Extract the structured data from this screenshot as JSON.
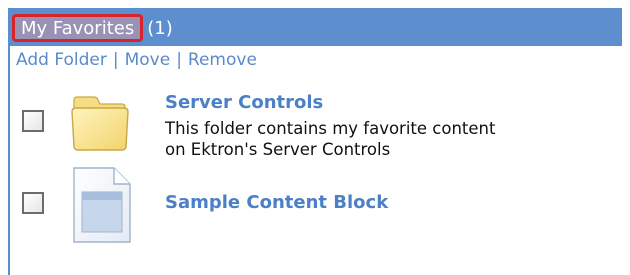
{
  "header": {
    "title": "My Favorites",
    "count": "(1)"
  },
  "actions": {
    "add_folder": "Add Folder",
    "move": "Move",
    "remove": "Remove",
    "separator": "|"
  },
  "items": [
    {
      "icon": "folder-icon",
      "title": "Server Controls",
      "description_line1": "This folder contains my favorite content",
      "description_line2": "on Ektron's Server Controls"
    },
    {
      "icon": "document-icon",
      "title": "Sample Content Block"
    }
  ],
  "colors": {
    "header_bg": "#5d8fce",
    "title_pill_bg": "#9a91b4",
    "highlight_border": "#d9232b",
    "link": "#4b7fc6",
    "folder_fill": "#fbe79a"
  }
}
